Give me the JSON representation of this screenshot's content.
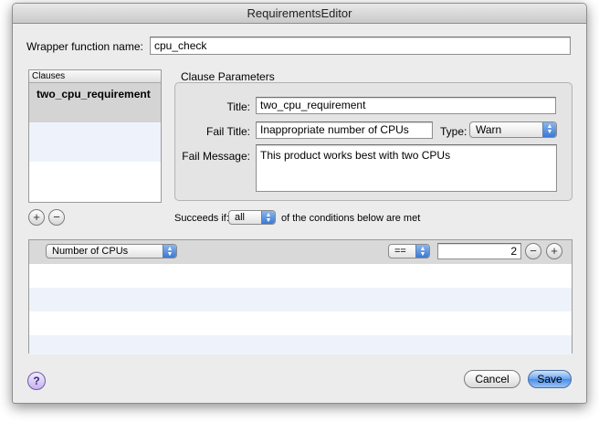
{
  "window": {
    "title": "RequirementsEditor"
  },
  "wrapper": {
    "label": "Wrapper function name:",
    "value": "cpu_check"
  },
  "clauses": {
    "header": "Clauses",
    "items": [
      "two_cpu_requirement"
    ]
  },
  "params": {
    "group_title": "Clause Parameters",
    "title_label": "Title:",
    "title_value": "two_cpu_requirement",
    "fail_title_label": "Fail Title:",
    "fail_title_value": "Inappropriate number of CPUs",
    "type_label": "Type:",
    "type_value": "Warn",
    "fail_message_label": "Fail Message:",
    "fail_message_value": "This product works best with two CPUs"
  },
  "list_buttons": {
    "add": "+",
    "remove": "−"
  },
  "succeeds": {
    "label": "Succeeds if:",
    "value": "all",
    "suffix": "of the conditions below are met"
  },
  "condition": {
    "property": "Number of CPUs",
    "operator": "==",
    "value": "2",
    "remove": "−",
    "add": "+"
  },
  "buttons": {
    "help": "?",
    "cancel": "Cancel",
    "save": "Save"
  },
  "colors": {
    "accent": "#4b8ce6",
    "window_bg": "#ececec",
    "selection": "#d4d4d4"
  },
  "icons": {
    "help": "question-mark-icon",
    "add": "plus-icon",
    "remove": "minus-icon"
  }
}
